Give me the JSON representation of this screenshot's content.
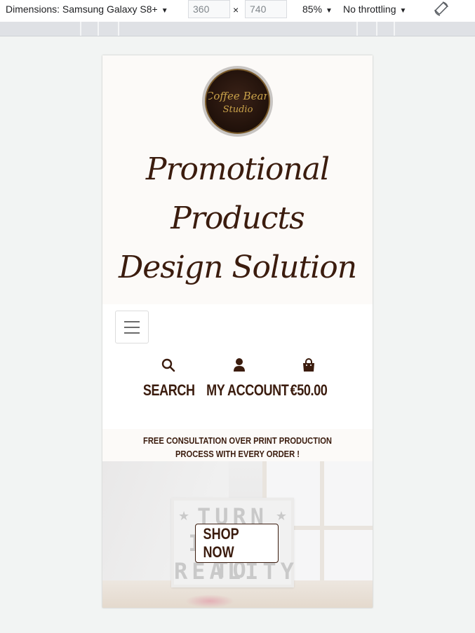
{
  "devtools": {
    "dimensions_label": "Dimensions: Samsung Galaxy S8+",
    "width_value": "360",
    "height_value": "740",
    "times_sign": "×",
    "zoom": "85%",
    "throttling": "No throttling",
    "dropdown_arrow": "▼",
    "rotate_icon": "rotate-icon"
  },
  "site": {
    "logo_text_line1": "Coffee Bean",
    "logo_text_line2": "Studio",
    "title": "Promotional Products Design Solution",
    "title_color": "#3b1c0e",
    "header_bg": "#fcfaf8"
  },
  "nav": {
    "menu_icon": "hamburger-icon",
    "search_label": "SEARCH",
    "account_label": "MY ACCOUNT",
    "cart_label": "€50.00"
  },
  "promo": {
    "text": "FREE CONSULTATION OVER PRINT PRODUCTION PROCESS WITH EVERY ORDER !"
  },
  "hero": {
    "lightbox_line1": "TURN",
    "lightbox_line2": "IDEAS TO",
    "lightbox_line3": "REALITY",
    "star": "★",
    "button_label": "SHOP NOW"
  }
}
